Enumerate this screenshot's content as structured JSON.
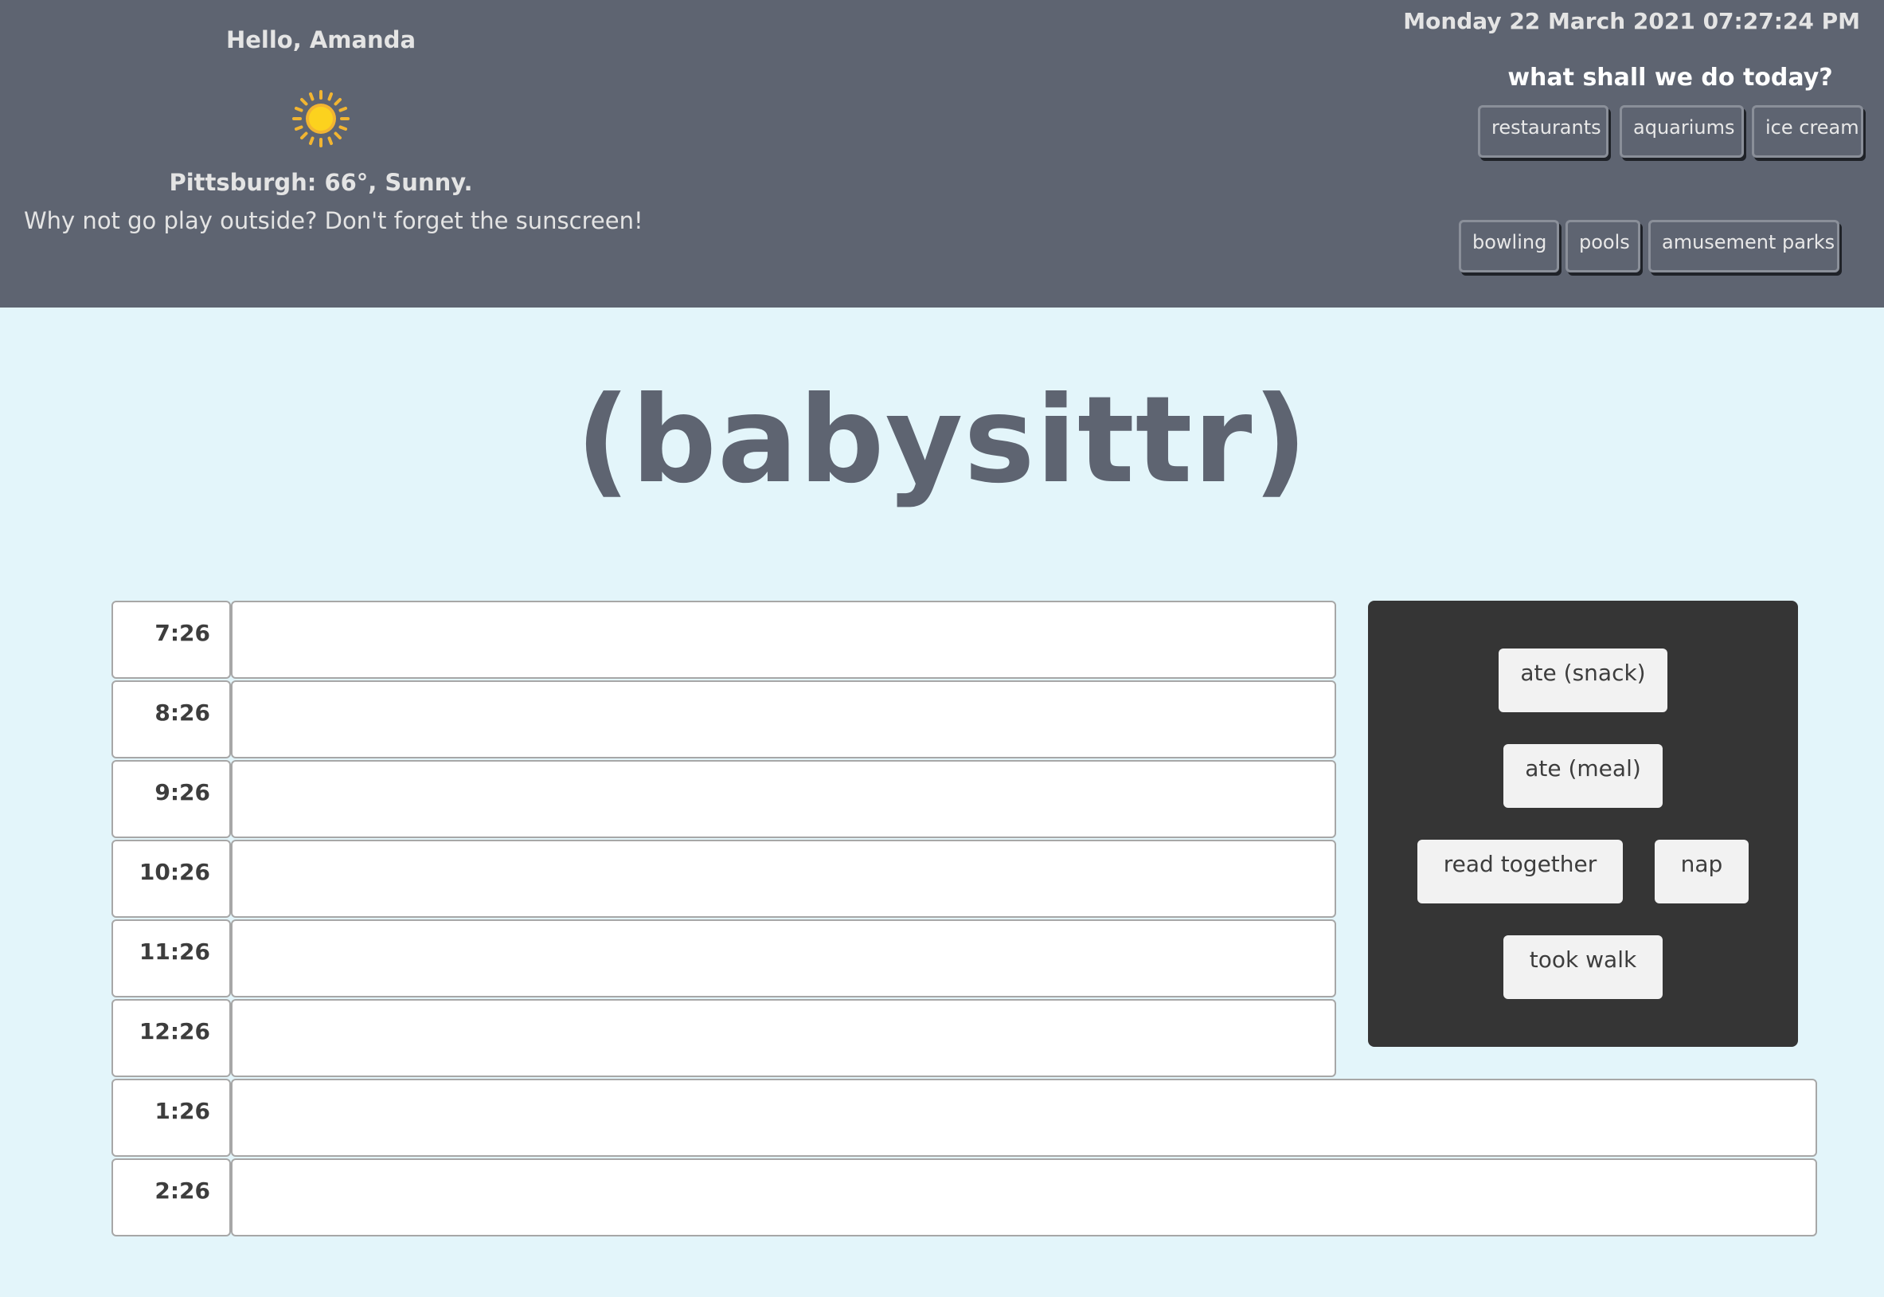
{
  "header": {
    "greeting": "Hello, Amanda",
    "weather_icon": "sun-icon",
    "weather_line": "Pittsburgh: 66°, Sunny.",
    "weather_tip": "Why not go play outside? Don't forget the sunscreen!",
    "datetime": "Monday 22 March 2021 07:27:24 PM",
    "todo_title": "what shall we do today?",
    "activities": [
      "restaurants",
      "aquariums",
      "ice cream",
      "bowling",
      "pools",
      "amusement parks"
    ]
  },
  "logo": "(babysittr)",
  "schedule": {
    "times": [
      "7:26",
      "8:26",
      "9:26",
      "10:26",
      "11:26",
      "12:26",
      "1:26",
      "2:26"
    ]
  },
  "palette": {
    "items": [
      "ate (snack)",
      "ate (meal)",
      "read together",
      "nap",
      "took walk"
    ]
  },
  "colors": {
    "header_bg": "#5e6471",
    "page_bg": "#e3f5fa",
    "palette_bg": "#353535",
    "sun": "#f9c320"
  }
}
